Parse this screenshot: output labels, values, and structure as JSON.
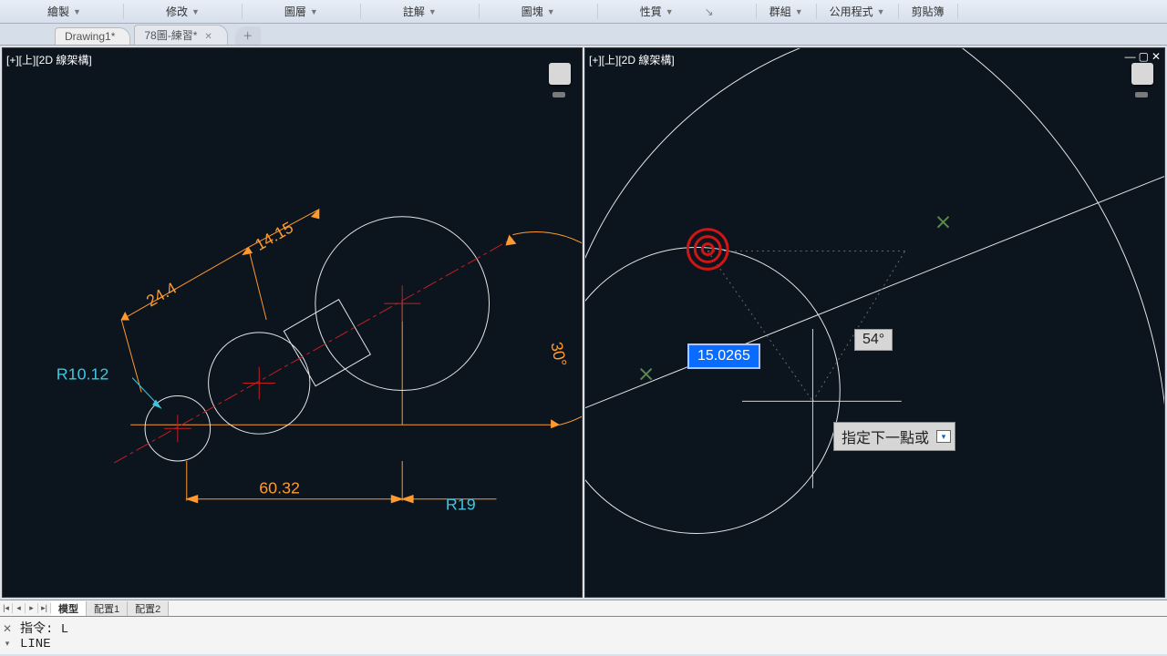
{
  "ribbon": {
    "panels": [
      "繪製",
      "修改",
      "圖層",
      "註解",
      "圖塊",
      "性質",
      "群組",
      "公用程式",
      "剪貼簿"
    ]
  },
  "docTabs": {
    "tabs": [
      {
        "label": "Drawing1*"
      },
      {
        "label": "78圖-練習*"
      }
    ]
  },
  "viewTitle": "[+][上][2D 線架構]",
  "leftDrawing": {
    "dim_24_4": "24.4",
    "dim_14_15": "14.15",
    "r10_12": "R10.12",
    "dim_60_32": "60.32",
    "r19": "R19",
    "ang_30": "30°"
  },
  "rightDrawing": {
    "dyn_distance": "15.0265",
    "dyn_angle": "54°",
    "dyn_prompt": "指定下一點或"
  },
  "layoutTabs": {
    "tabs": [
      "模型",
      "配置1",
      "配置2"
    ]
  },
  "cmd": {
    "line1": "指令: L",
    "line2": "LINE"
  }
}
